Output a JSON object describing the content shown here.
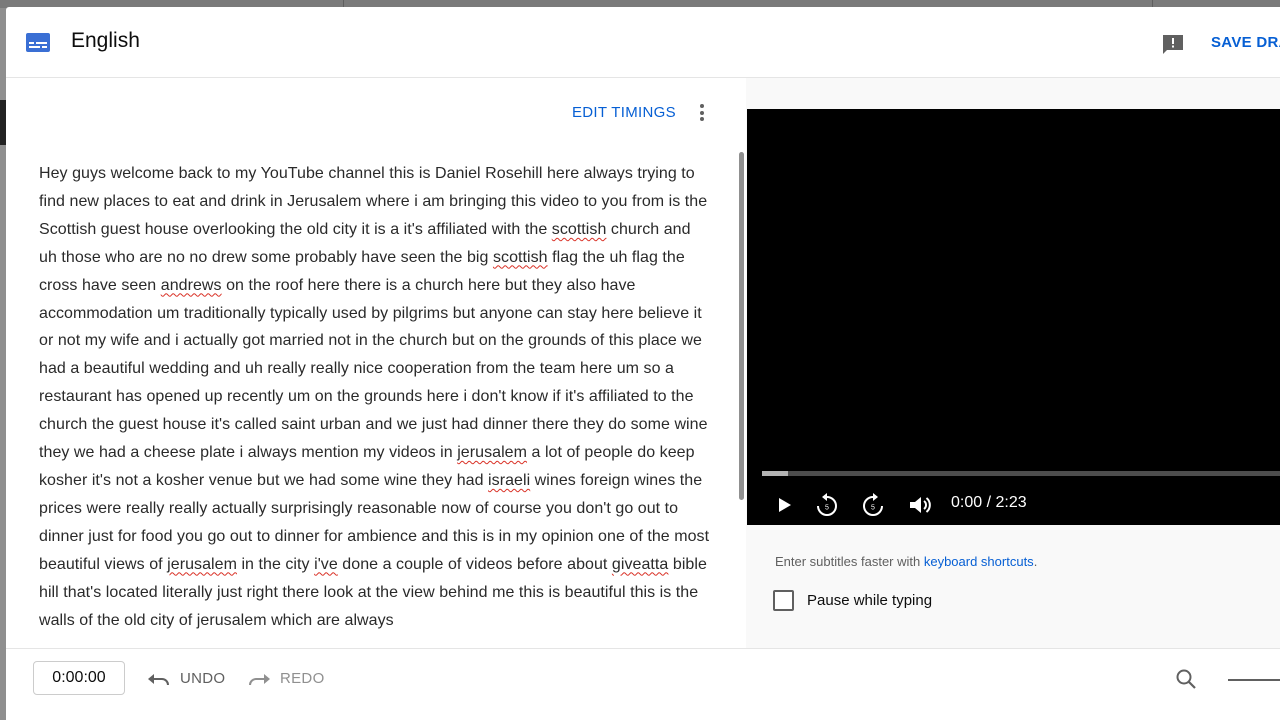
{
  "header": {
    "title": "English",
    "save_draft_label": "SAVE DRAFT",
    "subtitles_icon": "subtitles-icon",
    "feedback_icon": "feedback-icon"
  },
  "editor": {
    "edit_timings_label": "EDIT TIMINGS",
    "more_icon": "more-vert-icon",
    "transcript_segments": [
      "Hey guys welcome back to my YouTube channel this is Daniel Rosehill here always trying to find new places to eat and drink in Jerusalem where i am bringing this video to you from is the Scottish guest house overlooking the old city it is a it's affiliated with the ",
      "scottish",
      " church and uh those who are no no drew some probably have seen the big ",
      "scottish",
      " flag the uh flag the cross have seen ",
      "andrews",
      " on the roof here there is a church here but they also have accommodation um traditionally typically used by pilgrims but anyone can stay here believe it or not my wife and i actually got married not in the church but on the grounds of this place we had a beautiful wedding and uh really really nice cooperation from the team here um so a restaurant has opened up recently um on the grounds here i don't know if it's affiliated to the church the guest house it's called saint urban and we just had dinner there they do some wine they we had a cheese plate i always mention my videos in ",
      "jerusalem",
      " a lot of people do keep kosher it's not a kosher venue but we had some wine they had ",
      "israeli",
      " wines foreign wines the prices were really really actually surprisingly reasonable now of course you don't go out to dinner just for food you go out to dinner for ambience and this is in my opinion one of the most beautiful views of ",
      "jerusalem",
      " in the city ",
      "i've",
      " done a couple of videos before about ",
      "giveatta",
      " bible hill that's located literally just right there look at the view behind me this is beautiful this is the walls of the old city of jerusalem which are always"
    ]
  },
  "player": {
    "time_display": "0:00 / 2:23",
    "progress_fraction": 0.05,
    "play_icon": "play-icon",
    "rewind_icon": "replay-5-icon",
    "forward_icon": "forward-5-icon",
    "volume_icon": "volume-icon"
  },
  "options": {
    "hint_text": "Enter subtitles faster with ",
    "hint_link": "keyboard shortcuts",
    "hint_end": ".",
    "pause_label": "Pause while typing",
    "pause_checked": false
  },
  "bottom": {
    "time_value": "0:00:00",
    "undo_label": "UNDO",
    "redo_label": "REDO",
    "zoom_icon": "zoom-icon"
  },
  "colors": {
    "accent": "#065fd4",
    "video_bg": "#000000",
    "spell_underline": "#d93025"
  }
}
